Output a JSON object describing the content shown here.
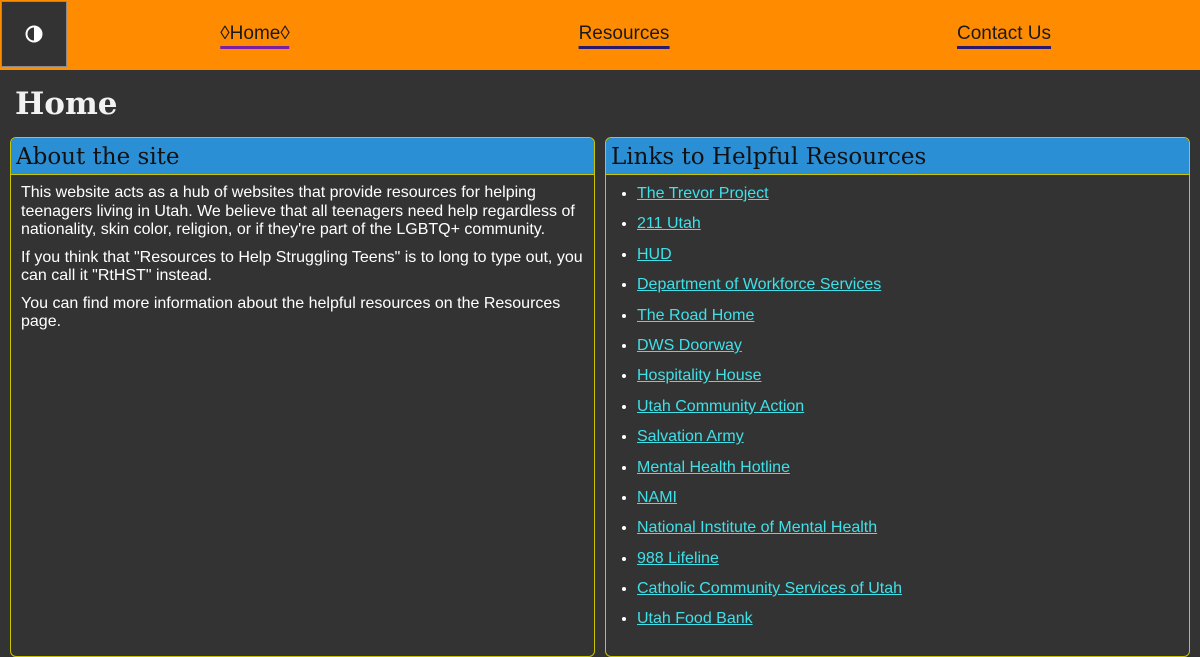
{
  "nav": {
    "toggle_icon": "contrast-icon",
    "items": [
      {
        "label": "◊Home◊",
        "active": true
      },
      {
        "label": "Resources",
        "active": false
      },
      {
        "label": "Contact Us",
        "active": false
      }
    ]
  },
  "page": {
    "title": "Home"
  },
  "about": {
    "heading": "About the site",
    "paragraphs": [
      "This website acts as a hub of websites that provide resources for helping teenagers living in Utah. We believe that all teenagers need help regardless of nationality, skin color, religion, or if they're part of the LGBTQ+ community.",
      "If you think that \"Resources to Help Struggling Teens\" is to long to type out, you can call it \"RtHST\" instead.",
      "You can find more information about the helpful resources on the Resources page."
    ]
  },
  "links": {
    "heading": "Links to Helpful Resources",
    "items": [
      "The Trevor Project",
      "211 Utah",
      "HUD",
      "Department of Workforce Services",
      "The Road Home",
      "DWS Doorway",
      "Hospitality House",
      "Utah Community Action",
      "Salvation Army",
      "Mental Health Hotline",
      "NAMI",
      "National Institute of Mental Health",
      "988 Lifeline",
      "Catholic Community Services of Utah",
      "Utah Food Bank"
    ]
  },
  "colors": {
    "nav_bg": "#ff8c00",
    "page_bg": "#333333",
    "panel_header_bg": "#2b8fd6",
    "panel_border": "#c9c400",
    "link": "#3fe0e8"
  }
}
